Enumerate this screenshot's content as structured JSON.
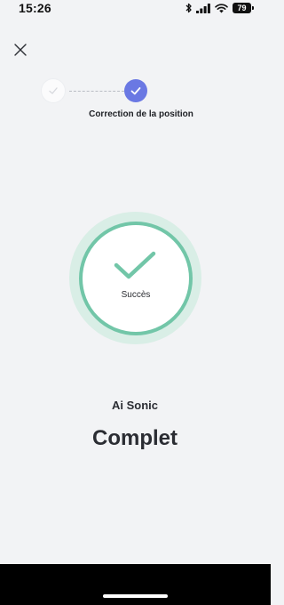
{
  "status_bar": {
    "time": "15:26",
    "battery": "79",
    "icons": [
      "bluetooth-icon",
      "signal-icon",
      "wifi-icon",
      "battery-icon"
    ]
  },
  "header": {
    "close_icon": "close-icon"
  },
  "stepper": {
    "steps": [
      {
        "state": "completed-inactive",
        "icon": "check-icon"
      },
      {
        "state": "active",
        "icon": "check-icon",
        "label": "Correction de la position"
      }
    ]
  },
  "result": {
    "icon": "check-icon",
    "status_text": "Succès",
    "device_name": "Ai Sonic",
    "title": "Complet"
  },
  "colors": {
    "background": "#f2f3f5",
    "accent": "#6a78e3",
    "success": "#72c6a8",
    "success_halo": "#d9eee6",
    "text_primary": "#2b2d33"
  }
}
